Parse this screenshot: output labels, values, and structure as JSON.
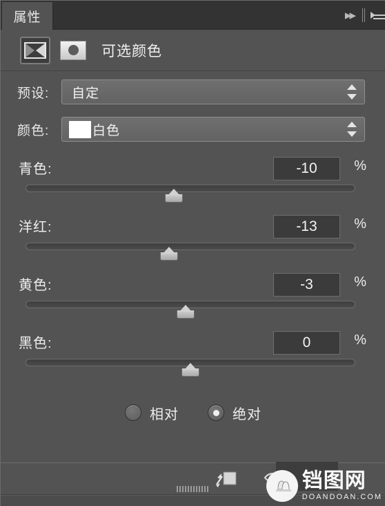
{
  "window": {
    "tab_label": "属性",
    "collapse_icon": "double-chevron-right-icon",
    "menu_icon": "panel-menu-icon"
  },
  "header": {
    "adjustment_icon": "selective-color-icon",
    "mask_thumbnail": "layer-mask-thumbnail",
    "title": "可选颜色"
  },
  "preset": {
    "label": "预设:",
    "value": "自定"
  },
  "color": {
    "label": "颜色:",
    "value": "白色",
    "swatch_hex": "#ffffff"
  },
  "sliders": [
    {
      "label": "青色:",
      "value": "-10",
      "unit": "%",
      "percent": 45
    },
    {
      "label": "洋红:",
      "value": "-13",
      "unit": "%",
      "percent": 43.5
    },
    {
      "label": "黄色:",
      "value": "-3",
      "unit": "%",
      "percent": 48.5
    },
    {
      "label": "黑色:",
      "value": "0",
      "unit": "%",
      "percent": 50
    }
  ],
  "method": {
    "relative": {
      "label": "相对",
      "selected": false
    },
    "absolute": {
      "label": "绝对",
      "selected": true
    }
  },
  "footer": {
    "clip_icon": "clip-to-layer-icon",
    "preview_icon": "toggle-visibility-eye-icon",
    "reset_icon": "reset-arrow-icon",
    "grip": "resize-grip"
  },
  "watermark": {
    "cn": "铛图网",
    "en": "DOANDOAN.COM",
    "badge_icon": "bell-logo-icon"
  }
}
